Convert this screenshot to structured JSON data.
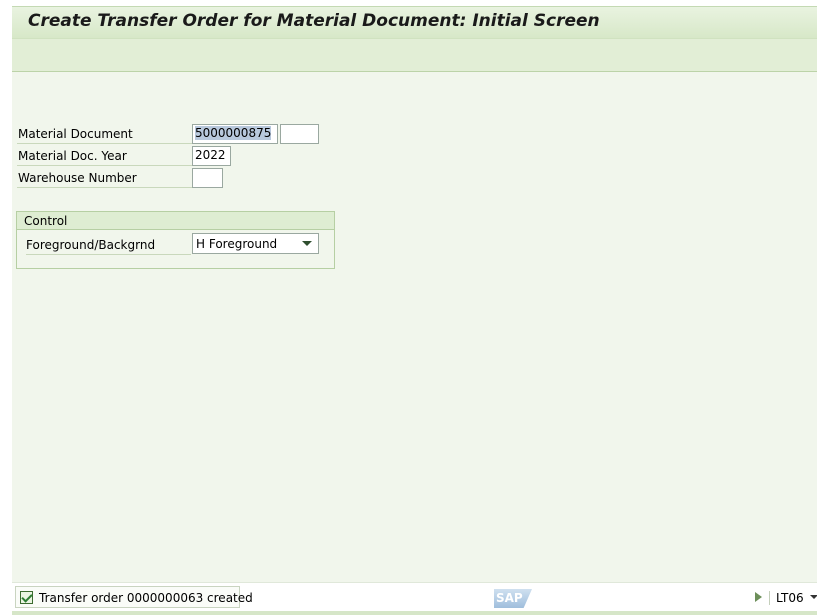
{
  "header": {
    "title": "Create Transfer Order for Material Document: Initial Screen"
  },
  "form": {
    "material_document": {
      "label": "Material Document",
      "value": "5000000875",
      "item_value": ""
    },
    "material_doc_year": {
      "label": "Material Doc. Year",
      "value": "2022"
    },
    "warehouse_number": {
      "label": "Warehouse Number",
      "value": ""
    }
  },
  "control": {
    "title": "Control",
    "foreground_label": "Foreground/Backgrnd",
    "foreground_value": "H Foreground"
  },
  "status": {
    "message": "Transfer order 0000000063 created",
    "transaction": "LT06",
    "logo": "SAP"
  },
  "colors": {
    "header_bg": "#d7e8c8",
    "content_bg": "#f1f6ec",
    "success_check": "#2e7d32"
  }
}
